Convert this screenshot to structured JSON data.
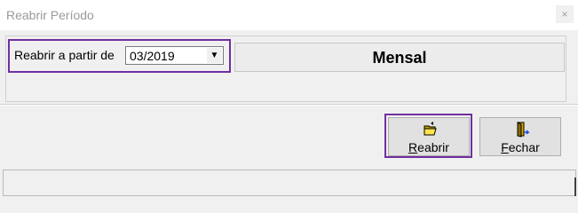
{
  "window": {
    "title": "Reabrir Período",
    "close_glyph": "×"
  },
  "period": {
    "label": "Reabrir a partir de",
    "selected": "03/2019",
    "dropdown_glyph": "▼"
  },
  "mode": {
    "value": "Mensal"
  },
  "buttons": {
    "reabrir": {
      "label_mnemonic": "R",
      "label_rest": "eabrir",
      "icon": "open-folder-icon"
    },
    "fechar": {
      "label_mnemonic": "F",
      "label_rest": "echar",
      "icon": "exit-door-icon"
    }
  },
  "colors": {
    "highlight": "#7030a0",
    "dialog_bg": "#f0f0f0",
    "button_bg": "#e1e1e1"
  }
}
